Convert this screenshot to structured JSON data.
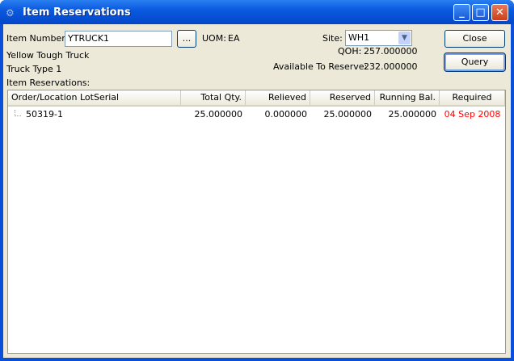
{
  "window": {
    "title": "Item Reservations",
    "icon": "gears-icon"
  },
  "form": {
    "item_number_label": "Item Number:",
    "item_number_value": "YTRUCK1",
    "lookup_label": "...",
    "uom_label": "UOM:",
    "uom_value": "EA",
    "description1": "Yellow Tough Truck",
    "description2": "Truck Type 1",
    "site_label": "Site:",
    "site_value": "WH1",
    "qoh_label": "QOH:",
    "qoh_value": "257.000000",
    "available_label": "Available To Reserve:",
    "available_value": "232.000000",
    "list_label": "Item Reservations:"
  },
  "buttons": {
    "close": "Close",
    "query": "Query"
  },
  "table": {
    "columns": [
      "Order/Location LotSerial",
      "Total Qty.",
      "Relieved",
      "Reserved",
      "Running Bal.",
      "Required"
    ],
    "rows": [
      {
        "order": "50319-1",
        "total_qty": "25.000000",
        "relieved": "0.000000",
        "reserved": "25.000000",
        "running_bal": "25.000000",
        "required": "04 Sep 2008"
      }
    ]
  },
  "colors": {
    "overdue": "#ff0000"
  }
}
